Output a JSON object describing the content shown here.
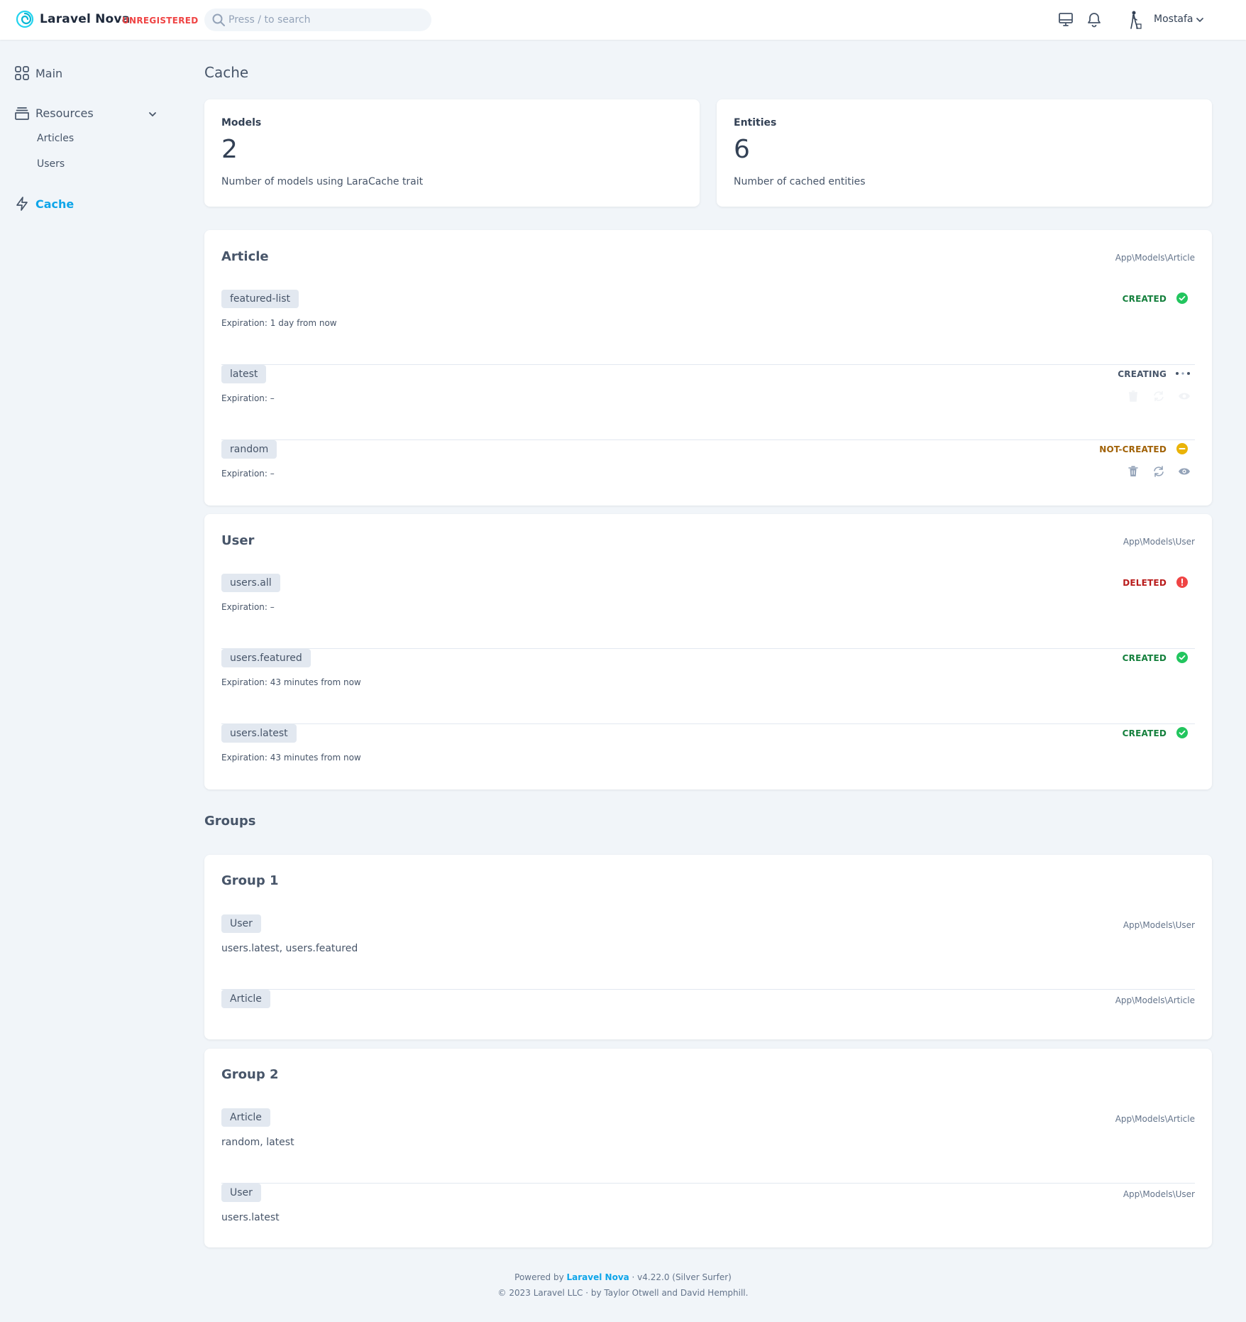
{
  "header": {
    "brand": "Laravel Nova",
    "license": "UNREGISTERED",
    "search_placeholder": "Press / to search",
    "user_name": "Mostafa",
    "icons": [
      "monitor-icon",
      "bell-icon",
      "chevron-down-icon"
    ]
  },
  "sidebar": {
    "main": "Main",
    "resources": "Resources",
    "articles": "Articles",
    "users": "Users",
    "cache": "Cache"
  },
  "page": {
    "title": "Cache"
  },
  "metrics": {
    "models": {
      "label": "Models",
      "value": "2",
      "desc": "Number of models using LaraCache trait"
    },
    "entities": {
      "label": "Entities",
      "value": "6",
      "desc": "Number of cached entities"
    }
  },
  "article": {
    "title": "Article",
    "path": "App\\Models\\Article",
    "entries": [
      {
        "key": "featured-list",
        "expiration": "Expiration: 1 day from now",
        "status": "CREATED"
      },
      {
        "key": "latest",
        "expiration": "Expiration: –",
        "status": "CREATING"
      },
      {
        "key": "random",
        "expiration": "Expiration: –",
        "status": "NOT-CREATED"
      }
    ]
  },
  "user": {
    "title": "User",
    "path": "App\\Models\\User",
    "entries": [
      {
        "key": "users.all",
        "expiration": "Expiration: –",
        "status": "DELETED"
      },
      {
        "key": "users.featured",
        "expiration": "Expiration: 43 minutes from now",
        "status": "CREATED"
      },
      {
        "key": "users.latest",
        "expiration": "Expiration: 43 minutes from now",
        "status": "CREATED"
      }
    ]
  },
  "groups": {
    "title": "Groups",
    "list": [
      {
        "title": "Group 1",
        "items": [
          {
            "model": "User",
            "path": "App\\Models\\User",
            "keys": "users.latest, users.featured"
          },
          {
            "model": "Article",
            "path": "App\\Models\\Article",
            "keys": ""
          }
        ]
      },
      {
        "title": "Group 2",
        "items": [
          {
            "model": "Article",
            "path": "App\\Models\\Article",
            "keys": "random, latest"
          },
          {
            "model": "User",
            "path": "App\\Models\\User",
            "keys": "users.latest"
          }
        ]
      }
    ]
  },
  "colors": {
    "accent": "#0ea5e9",
    "created": "#15803d",
    "created_icon": "#22c55e",
    "creating": "#475569",
    "not_created": "#a16207",
    "not_created_icon": "#eab308",
    "deleted": "#b91c1c",
    "deleted_icon": "#ef4444"
  },
  "footer": {
    "powered_prefix": "Powered by ",
    "nova": "Laravel Nova",
    "version": " · v4.22.0 (Silver Surfer)",
    "copyright": "© 2023 Laravel LLC · by Taylor Otwell and David Hemphill."
  }
}
